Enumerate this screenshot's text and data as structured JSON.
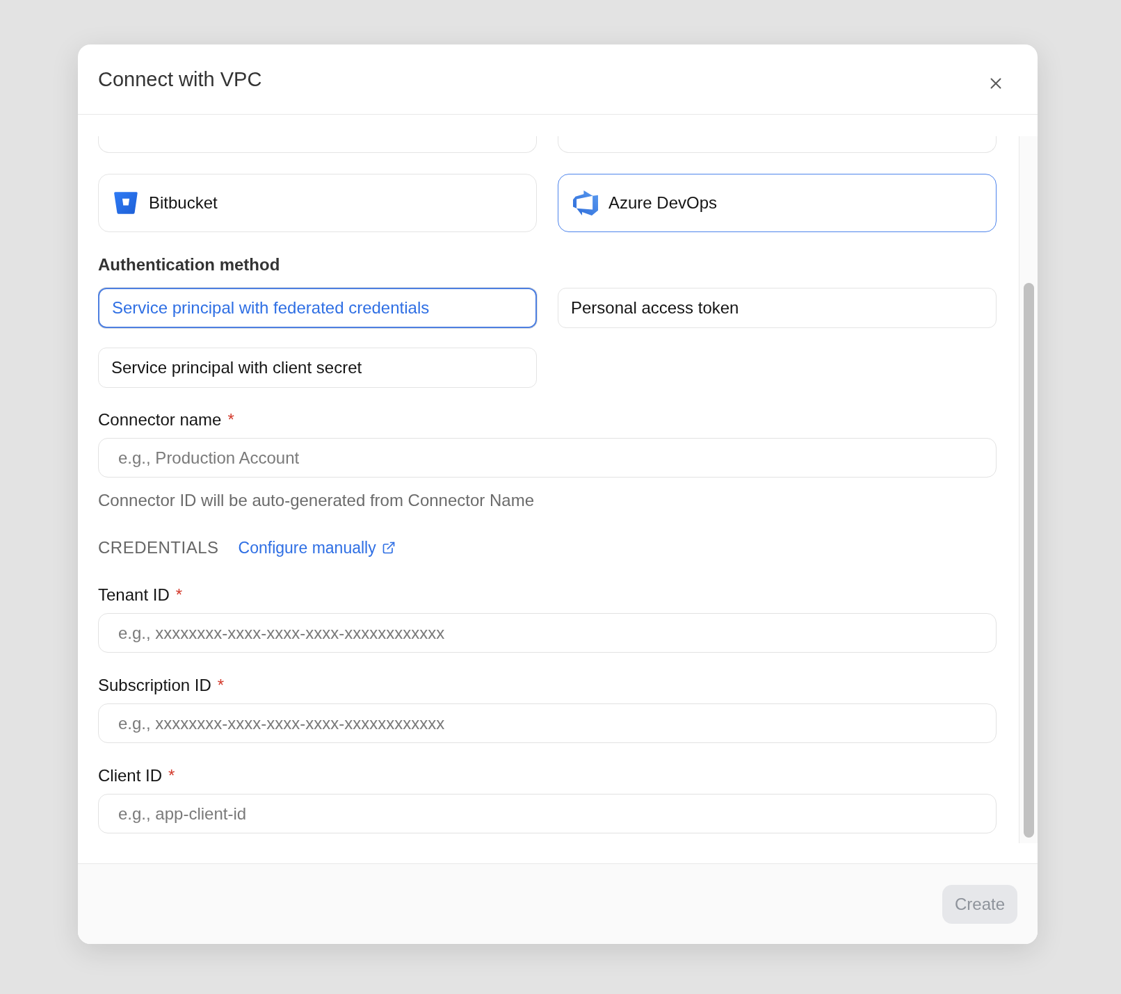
{
  "dialog": {
    "title": "Connect with VPC"
  },
  "providers": [
    {
      "name": "Bitbucket",
      "kind": "bitbucket",
      "selected": false
    },
    {
      "name": "Azure DevOps",
      "kind": "azure-devops",
      "selected": true
    }
  ],
  "auth_method": {
    "label": "Authentication method",
    "options": [
      {
        "label": "Service principal with federated credentials",
        "selected": true
      },
      {
        "label": "Personal access token",
        "selected": false
      },
      {
        "label": "Service principal with client secret",
        "selected": false
      }
    ]
  },
  "connector_name": {
    "label": "Connector name",
    "required_mark": "*",
    "placeholder": "e.g., Production Account",
    "help": "Connector ID will be auto-generated from Connector Name"
  },
  "credentials": {
    "heading": "CREDENTIALS",
    "link": "Configure manually",
    "fields": [
      {
        "label": "Tenant ID",
        "required_mark": "*",
        "placeholder": "e.g., xxxxxxxx-xxxx-xxxx-xxxx-xxxxxxxxxxxx"
      },
      {
        "label": "Subscription ID",
        "required_mark": "*",
        "placeholder": "e.g., xxxxxxxx-xxxx-xxxx-xxxx-xxxxxxxxxxxx"
      },
      {
        "label": "Client ID",
        "required_mark": "*",
        "placeholder": "e.g., app-client-id"
      }
    ]
  },
  "footer": {
    "create_button": {
      "label": "Create",
      "disabled": true
    }
  }
}
